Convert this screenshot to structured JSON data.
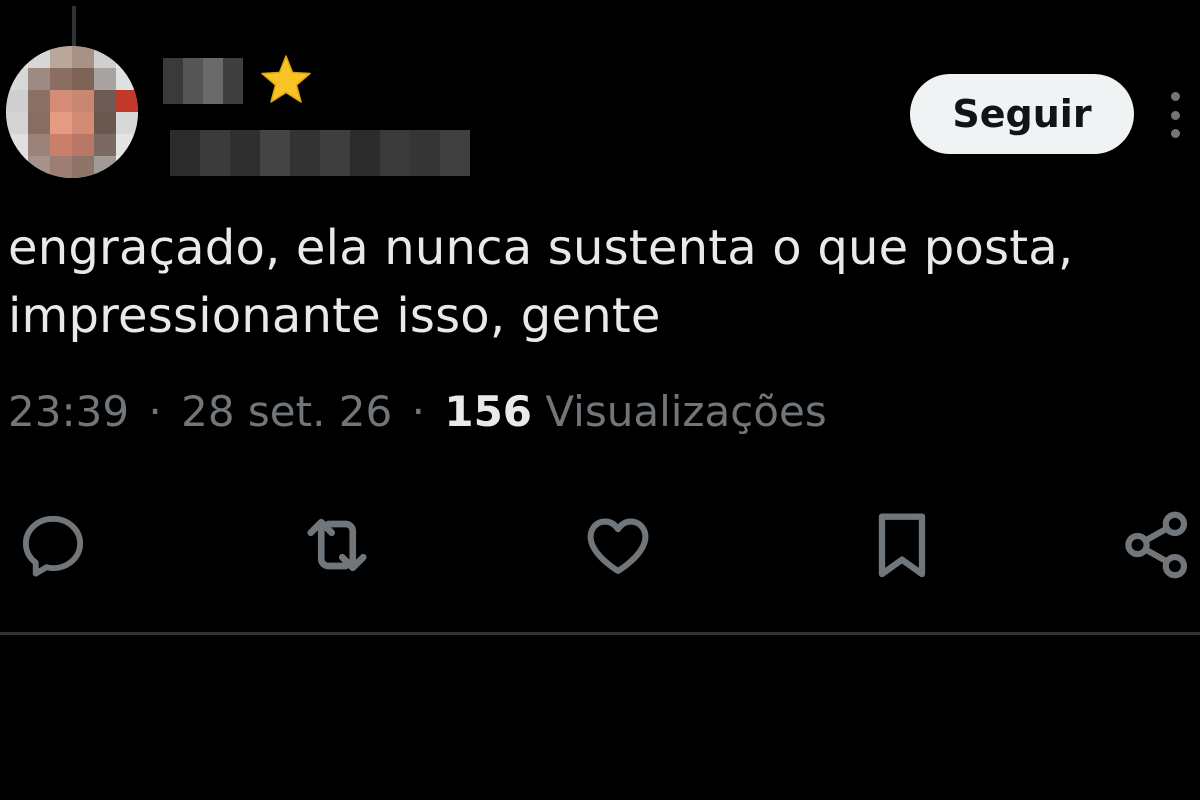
{
  "tweet": {
    "author": {
      "name_blurred": true,
      "handle_blurred": true,
      "badge_icon": "star-emoji-icon"
    },
    "follow_label": "Seguir",
    "more_icon": "more-vertical-icon",
    "text_lines": [
      "engraçado, ela nunca sustenta o que posta,",
      "impressionante isso, gente"
    ],
    "meta": {
      "time": "23:39",
      "separator": "·",
      "date": "28 set. 26",
      "views_count": "156",
      "views_label": "Visualizações"
    },
    "actions": [
      {
        "icon": "reply-icon"
      },
      {
        "icon": "retweet-icon"
      },
      {
        "icon": "like-heart-icon"
      },
      {
        "icon": "bookmark-icon"
      },
      {
        "icon": "share-icon"
      }
    ]
  },
  "colors": {
    "background": "#000000",
    "text_primary": "#e7e9ea",
    "text_secondary": "#71767b",
    "button_bg": "#eff3f4",
    "button_text": "#0f1419",
    "divider": "#2f3336",
    "star": "#f7c325"
  }
}
